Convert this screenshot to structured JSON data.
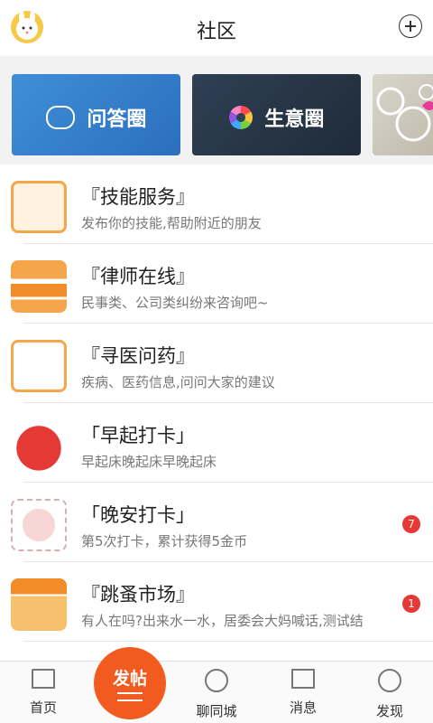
{
  "header": {
    "title": "社区",
    "add_icon": "plus-circle-icon",
    "avatar_icon": "bunny-avatar"
  },
  "banners": [
    {
      "label": "问答圈",
      "icon": "chat-bubble-icon",
      "color": "#2f7fd1"
    },
    {
      "label": "生意圈",
      "icon": "color-wheel-icon",
      "color": "#273545"
    },
    {
      "label": "",
      "icon": "decor-image",
      "color": "#cfc9bd"
    }
  ],
  "list": [
    {
      "name": "『技能服务』",
      "desc": "发布你的技能,帮助附近的朋友",
      "icon": "bowtie-shirt-icon",
      "badge": ""
    },
    {
      "name": "『律师在线』",
      "desc": "民事类、公司类纠纷来咨询吧~",
      "icon": "books-icon",
      "badge": ""
    },
    {
      "name": "『寻医问药』",
      "desc": "疾病、医药信息,问问大家的建议",
      "icon": "medicine-icon",
      "badge": ""
    },
    {
      "name": "「早起打卡」",
      "desc": "早起床晚起床早晚起床",
      "icon": "red-bird-icon",
      "badge": ""
    },
    {
      "name": "「晚安打卡」",
      "desc": "第5次打卡，累计获得5金币",
      "icon": "pig-icon",
      "badge": "7"
    },
    {
      "name": "『跳蚤市场』",
      "desc": "有人在吗?出来水一水，居委会大妈喊话,测试结",
      "icon": "shop-icon",
      "badge": "1"
    }
  ],
  "tabbar": {
    "home": "首页",
    "post": "发帖",
    "city": "聊同城",
    "messages": "消息",
    "discover": "发现"
  },
  "colors": {
    "accent": "#f25b1f",
    "badge": "#e53935",
    "icon_orange": "#f6a64a"
  }
}
